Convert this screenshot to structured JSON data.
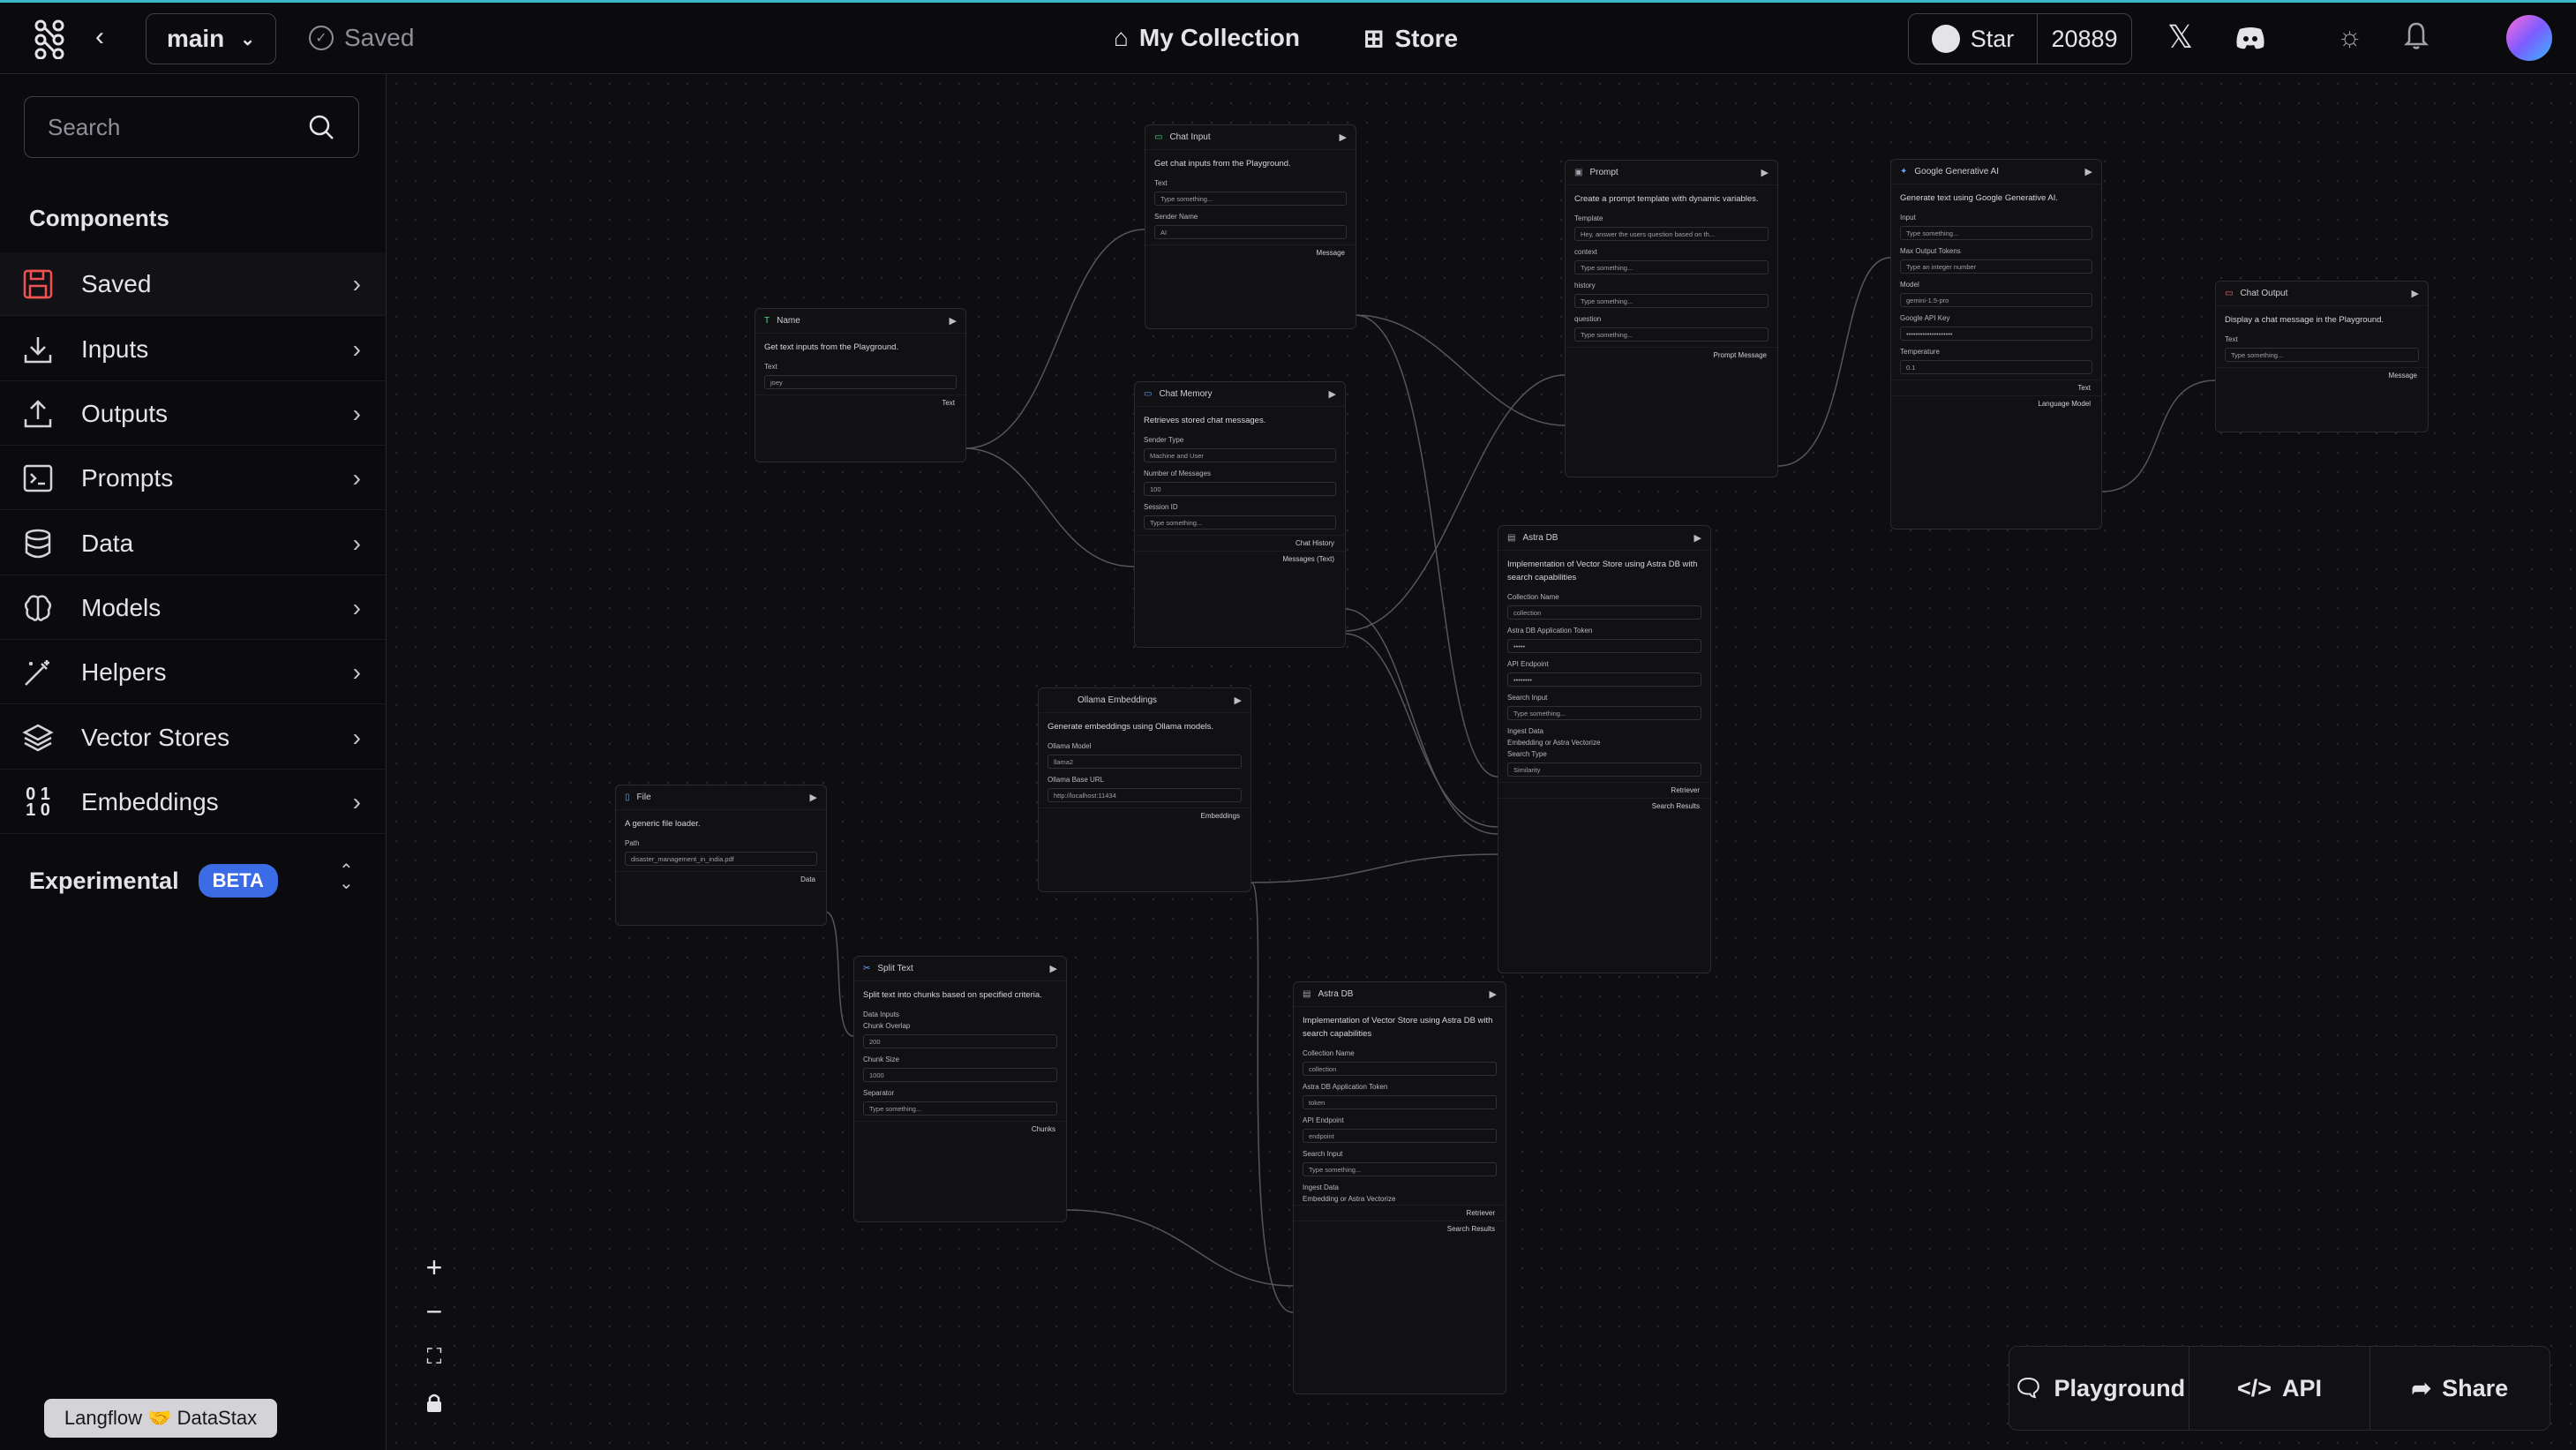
{
  "header": {
    "branch": "main",
    "saved_label": "Saved",
    "collection_label": "My Collection",
    "store_label": "Store",
    "star_label": "Star",
    "star_count": "20889"
  },
  "sidebar": {
    "search_placeholder": "Search",
    "components_title": "Components",
    "items": [
      {
        "label": "Saved",
        "icon": "save-icon"
      },
      {
        "label": "Inputs",
        "icon": "download-icon"
      },
      {
        "label": "Outputs",
        "icon": "upload-icon"
      },
      {
        "label": "Prompts",
        "icon": "terminal-icon"
      },
      {
        "label": "Data",
        "icon": "database-icon"
      },
      {
        "label": "Models",
        "icon": "brain-icon"
      },
      {
        "label": "Helpers",
        "icon": "wand-icon"
      },
      {
        "label": "Vector Stores",
        "icon": "layers-icon"
      },
      {
        "label": "Embeddings",
        "icon": "binary-icon"
      }
    ],
    "experimental_label": "Experimental",
    "beta_label": "BETA"
  },
  "footer_badge": "Langflow 🤝 DataStax",
  "bottom_bar": {
    "playground": "Playground",
    "api": "API",
    "share": "Share"
  },
  "nodes": {
    "chat_input": {
      "title": "Chat Input",
      "desc": "Get chat inputs from the Playground.",
      "f1": "Text",
      "p1": "Type something...",
      "f2": "Sender Name",
      "v2": "AI",
      "out": "Message"
    },
    "name": {
      "title": "Name",
      "desc": "Get text inputs from the Playground.",
      "f1": "Text",
      "v1": "joey",
      "out": "Text"
    },
    "chat_memory": {
      "title": "Chat Memory",
      "desc": "Retrieves stored chat messages.",
      "f1": "Sender Type",
      "v1": "Machine and User",
      "f2": "Number of Messages",
      "v2": "100",
      "f3": "Session ID",
      "p3": "Type something...",
      "out1": "Chat History",
      "out2": "Messages (Text)"
    },
    "prompt": {
      "title": "Prompt",
      "desc": "Create a prompt template with dynamic variables.",
      "f1": "Template",
      "v1": "Hey, answer the users question based on th...",
      "f2": "context",
      "p2": "Type something...",
      "f3": "history",
      "p3": "Type something...",
      "f4": "question",
      "p4": "Type something...",
      "out": "Prompt Message"
    },
    "google": {
      "title": "Google Generative AI",
      "desc": "Generate text using Google Generative AI.",
      "f1": "Input",
      "p1": "Type something...",
      "f2": "Max Output Tokens",
      "p2": "Type an integer number",
      "f3": "Model",
      "v3": "gemini-1.5-pro",
      "f4": "Google API Key",
      "v4": "••••••••••••••••••••",
      "f5": "Temperature",
      "v5": "0.1",
      "out1": "Text",
      "out2": "Language Model"
    },
    "chat_output": {
      "title": "Chat Output",
      "desc": "Display a chat message in the Playground.",
      "f1": "Text",
      "p1": "Type something...",
      "out": "Message"
    },
    "astra1": {
      "title": "Astra DB",
      "desc": "Implementation of Vector Store using Astra DB with search capabilities",
      "f1": "Collection Name",
      "v1": "collection",
      "f2": "Astra DB Application Token",
      "v2": "•••••",
      "f3": "API Endpoint",
      "v3": "••••••••",
      "f4": "Search Input",
      "p4": "Type something...",
      "f5": "Ingest Data",
      "f6": "Embedding or Astra Vectorize",
      "f7": "Search Type",
      "v7": "Similarity",
      "out1": "Retriever",
      "out2": "Search Results"
    },
    "ollama": {
      "title": "Ollama Embeddings",
      "desc": "Generate embeddings using Ollama models.",
      "f1": "Ollama Model",
      "v1": "llama2",
      "f2": "Ollama Base URL",
      "v2": "http://localhost:11434",
      "out": "Embeddings"
    },
    "file": {
      "title": "File",
      "desc": "A generic file loader.",
      "f1": "Path",
      "v1": "disaster_management_in_india.pdf",
      "out": "Data"
    },
    "split": {
      "title": "Split Text",
      "desc": "Split text into chunks based on specified criteria.",
      "f1": "Data Inputs",
      "f2": "Chunk Overlap",
      "v2": "200",
      "f3": "Chunk Size",
      "v3": "1000",
      "f4": "Separator",
      "p4": "Type something...",
      "out": "Chunks"
    },
    "astra2": {
      "title": "Astra DB",
      "desc": "Implementation of Vector Store using Astra DB with search capabilities",
      "f1": "Collection Name",
      "v1": "collection",
      "f2": "Astra DB Application Token",
      "v2": "token",
      "f3": "API Endpoint",
      "v3": "endpoint",
      "f4": "Search Input",
      "p4": "Type something...",
      "f5": "Ingest Data",
      "f6": "Embedding or Astra Vectorize",
      "out1": "Retriever",
      "out2": "Search Results"
    }
  }
}
